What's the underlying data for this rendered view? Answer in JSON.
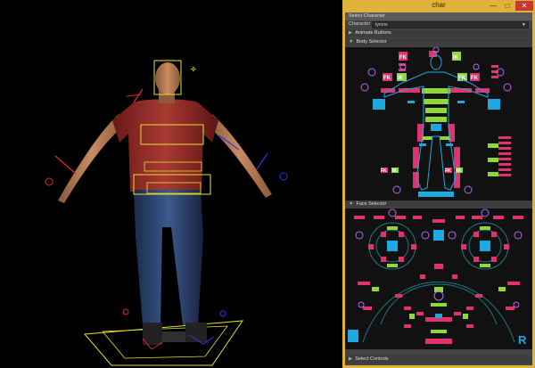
{
  "window": {
    "title": "char",
    "min_glyph": "—",
    "max_glyph": "□",
    "close_glyph": "✕"
  },
  "panel": {
    "select_character": "Select Character",
    "character_label": "Character",
    "character_value": "tyrone",
    "animate_buttons": "Animate Buttons",
    "body_selector": "Body Selector",
    "face_selector": "Face Selector",
    "select_controls": "Select Controls"
  },
  "body_tags": {
    "fk_left_top": "FK",
    "ik_right_top": "IK",
    "ik_left_mid": "IK",
    "fk_right_mid": "FK",
    "fk_arm_left": "FK",
    "ik_arm_right": "FK",
    "fk_foot_left": "FK",
    "ik_foot_left": "IK",
    "fk_foot_right": "FK",
    "ik_foot_right": "IK"
  },
  "face": {
    "reset_label": "R"
  },
  "colors": {
    "window_border": "#e0b23c",
    "pink": "#e0326e",
    "green": "#8fd83a",
    "cyan": "#1ea8e0",
    "purple": "#b46cf0"
  }
}
